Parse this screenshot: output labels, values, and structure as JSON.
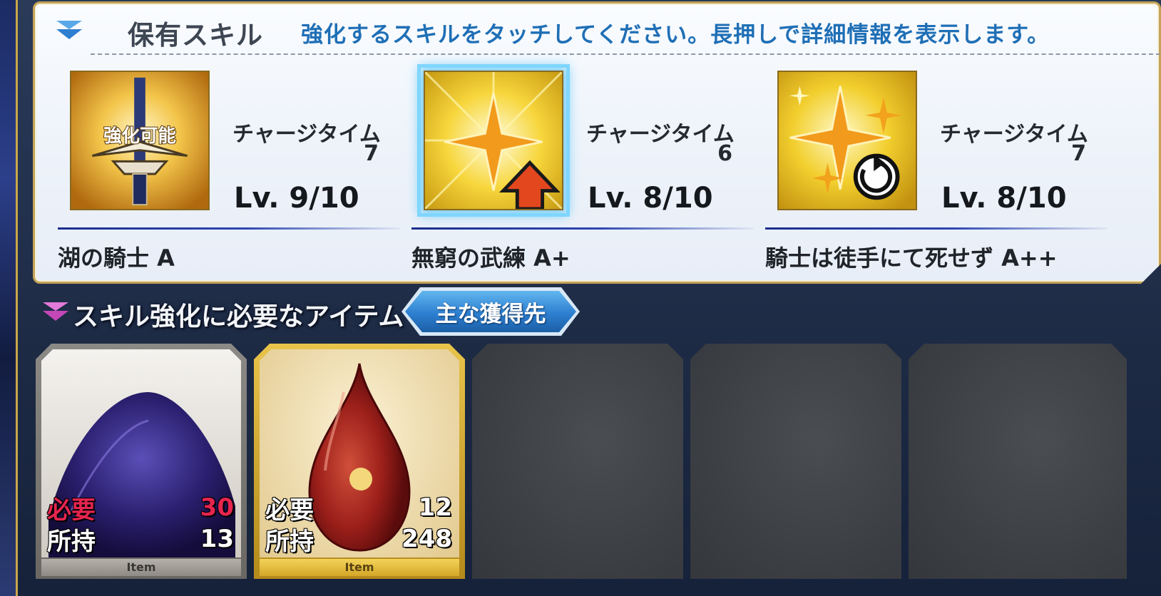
{
  "skills_panel": {
    "title": "保有スキル",
    "instruction": "強化するスキルをタッチしてください。長押しで詳細情報を表示します。",
    "skills": [
      {
        "name": "湖の騎士 A",
        "charge_label": "チャージタイム",
        "charge_value": "7",
        "level": "Lv. 9/10",
        "icon": "sword-icon",
        "badge": "強化可能",
        "selected": false
      },
      {
        "name": "無窮の武練 A+",
        "charge_label": "チャージタイム",
        "charge_value": "6",
        "level": "Lv. 8/10",
        "icon": "sparkle-up-arrow-icon",
        "selected": true
      },
      {
        "name": "騎士は徒手にて死せず A++",
        "charge_label": "チャージタイム",
        "charge_value": "7",
        "level": "Lv. 8/10",
        "icon": "sparkle-cycle-icon",
        "selected": false
      }
    ]
  },
  "items_section": {
    "title": "スキル強化に必要なアイテム",
    "source_button": "主な獲得先",
    "items": [
      {
        "need_label": "必要",
        "need_value": "30",
        "have_label": "所持",
        "have_value": "13",
        "tag": "Item",
        "icon": "dark-crystal-pile-icon",
        "insufficient": true
      },
      {
        "need_label": "必要",
        "need_value": "12",
        "have_label": "所持",
        "have_value": "248",
        "tag": "Item",
        "icon": "red-drop-icon",
        "insufficient": false
      }
    ],
    "empty_slots": 3
  },
  "colors": {
    "instruction": "#1f6fb6",
    "insufficient": "#e6254f",
    "panel_border": "#c4a357",
    "selected_glow": "#7fd6ff"
  }
}
